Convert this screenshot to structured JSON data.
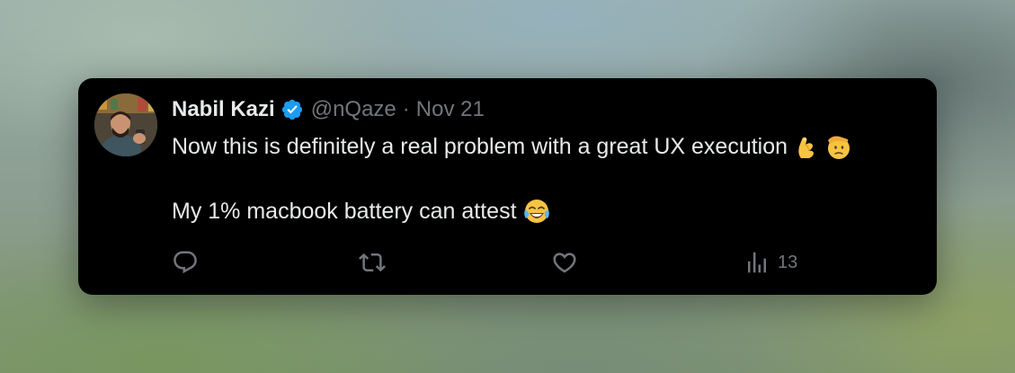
{
  "tweet": {
    "author_name": "Nabil Kazi",
    "handle": "@nQaze",
    "separator": "·",
    "date": "Nov 21",
    "verified": true,
    "line1": "Now this is definitely a real problem with a great UX execution",
    "line2": "My 1% macbook battery can attest",
    "line1_emojis": [
      "pinching-hand-emoji",
      "saluting-face-emoji"
    ],
    "line2_emojis": [
      "tears-of-joy-emoji"
    ]
  },
  "actions": {
    "reply_icon": "reply-icon",
    "retweet_icon": "retweet-icon",
    "like_icon": "heart-icon",
    "views_icon": "views-chart-icon",
    "views_count": "13"
  },
  "colors": {
    "card_background": "#000000",
    "primary_text": "#e7e9ea",
    "secondary_text": "#71767b",
    "verified_badge": "#1d9bf0"
  }
}
